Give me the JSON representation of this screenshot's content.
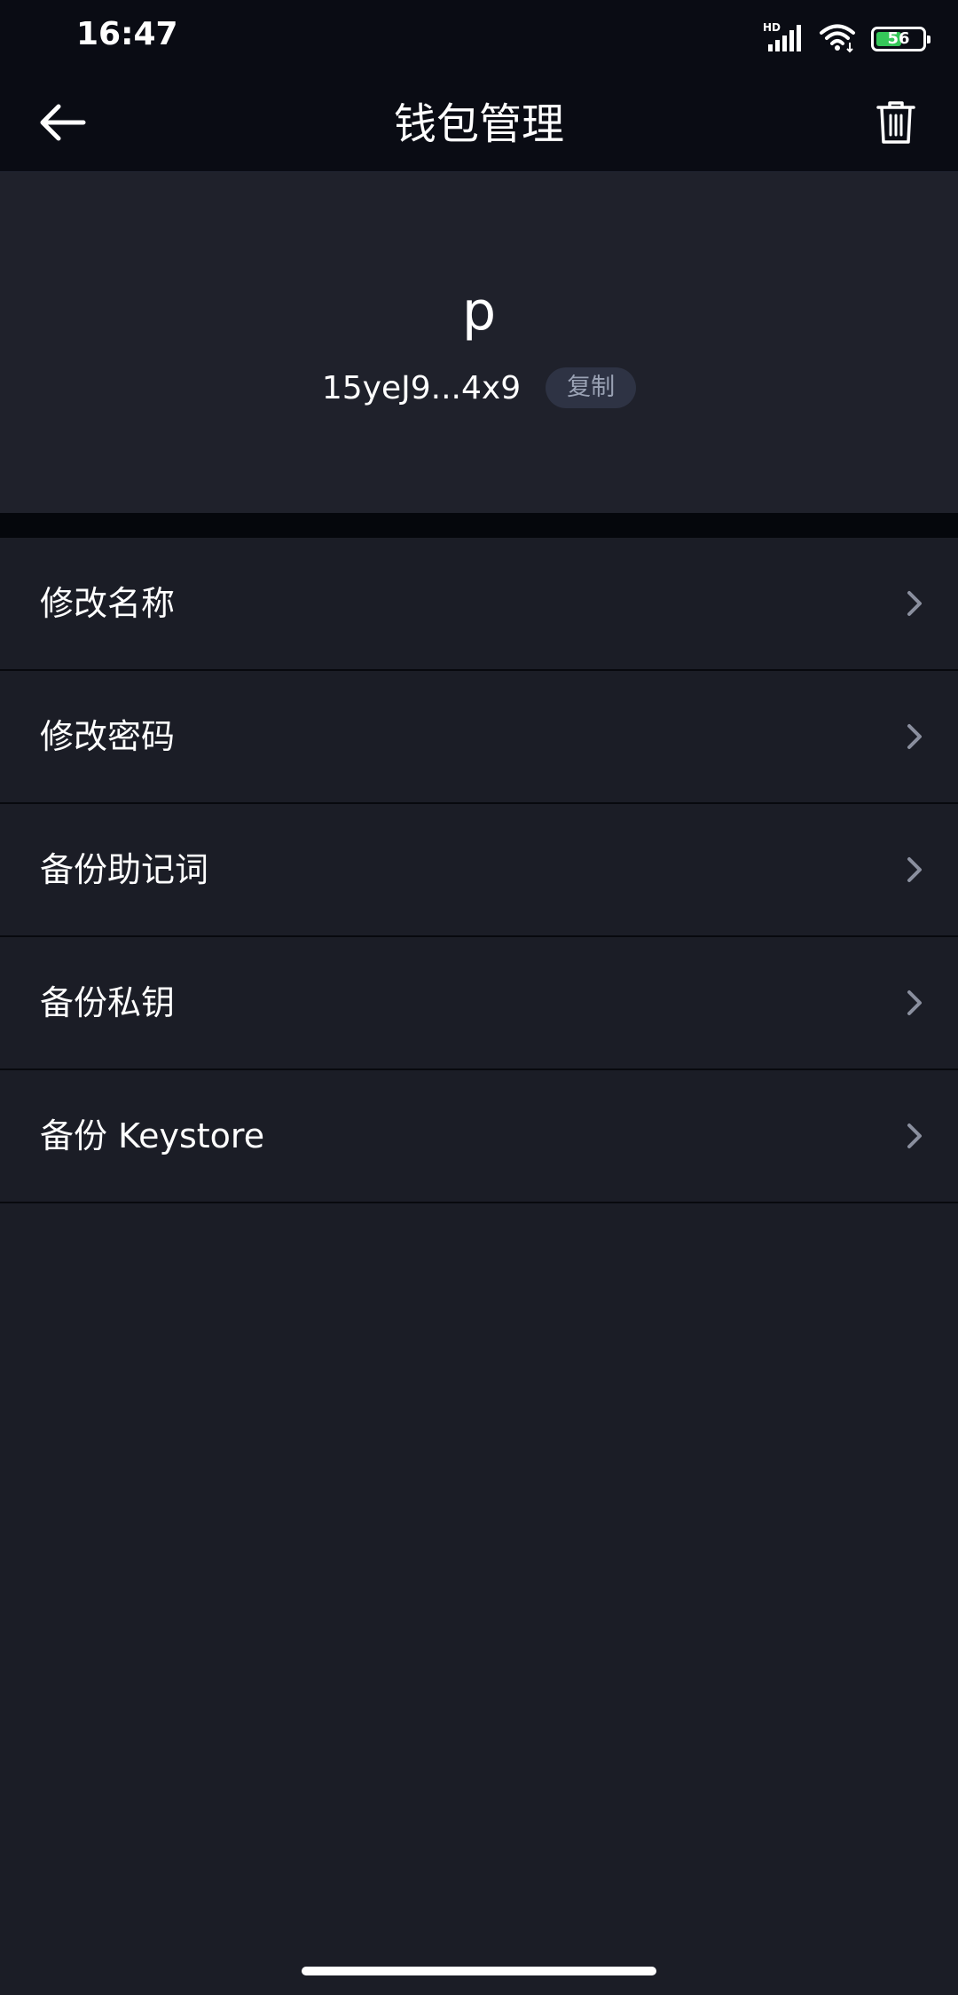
{
  "status_bar": {
    "time": "16:47",
    "network_label": "HD",
    "battery_level": "56",
    "battery_fraction": 0.56,
    "icons": [
      "signal-icon",
      "wifi-icon",
      "battery-icon"
    ]
  },
  "nav": {
    "title": "钱包管理",
    "back_icon": "arrow-left-icon",
    "delete_icon": "trash-icon"
  },
  "wallet": {
    "name": "p",
    "address": "15yeJ9...4x9",
    "copy_label": "复制"
  },
  "menu": {
    "items": [
      {
        "label": "修改名称"
      },
      {
        "label": "修改密码"
      },
      {
        "label": "备份助记词"
      },
      {
        "label": "备份私钥"
      },
      {
        "label": "备份 Keystore"
      }
    ],
    "chevron_icon": "chevron-right-icon"
  },
  "colors": {
    "background": "#1b1d26",
    "nav_background": "#0a0c14",
    "header_background": "#1f212b",
    "copy_badge": "#2e3344",
    "battery_green": "#35c759"
  }
}
